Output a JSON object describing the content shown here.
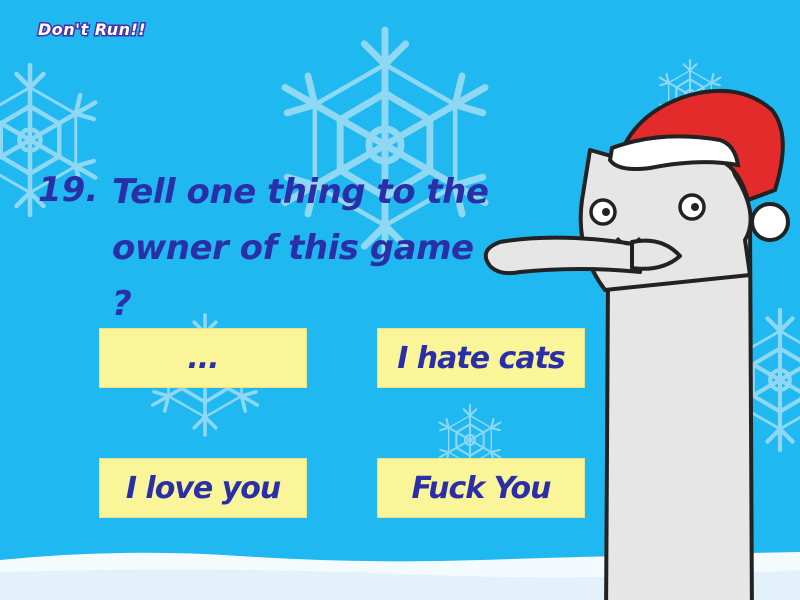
{
  "game": {
    "title": "Don't Run!!",
    "question_number": "19.",
    "question_line1": "Tell one thing to the",
    "question_line2": "owner of this game ?",
    "answers": [
      "...",
      "I hate cats",
      "I love you",
      "Fuck You"
    ]
  },
  "colors": {
    "sky": "#1fb8f0",
    "snowflake": "#8fd8f4",
    "answer_bg": "#fbf59a",
    "text": "#2a2fa8",
    "santa_hat": "#e32b2b"
  },
  "icons": [
    "snowflake-icon",
    "longcat-character",
    "santa-hat-icon"
  ]
}
